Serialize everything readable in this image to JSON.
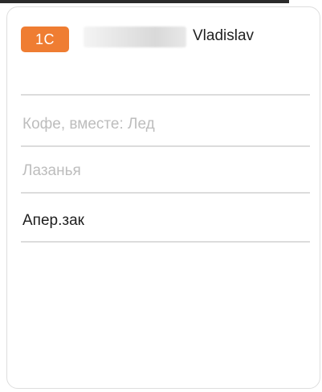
{
  "order": {
    "badge_label": "1С",
    "customer_name": "Vladislav"
  },
  "items": [
    {
      "label": "Кофе, вместе: Лед",
      "state": "inactive"
    },
    {
      "label": "Лазанья",
      "state": "inactive"
    },
    {
      "label": "Апер.зак",
      "state": "active"
    }
  ],
  "colors": {
    "badge": "#ef7d32",
    "inactive_text": "#bdbdbd",
    "active_text": "#1e1e1e",
    "divider": "#dcdcdc"
  }
}
